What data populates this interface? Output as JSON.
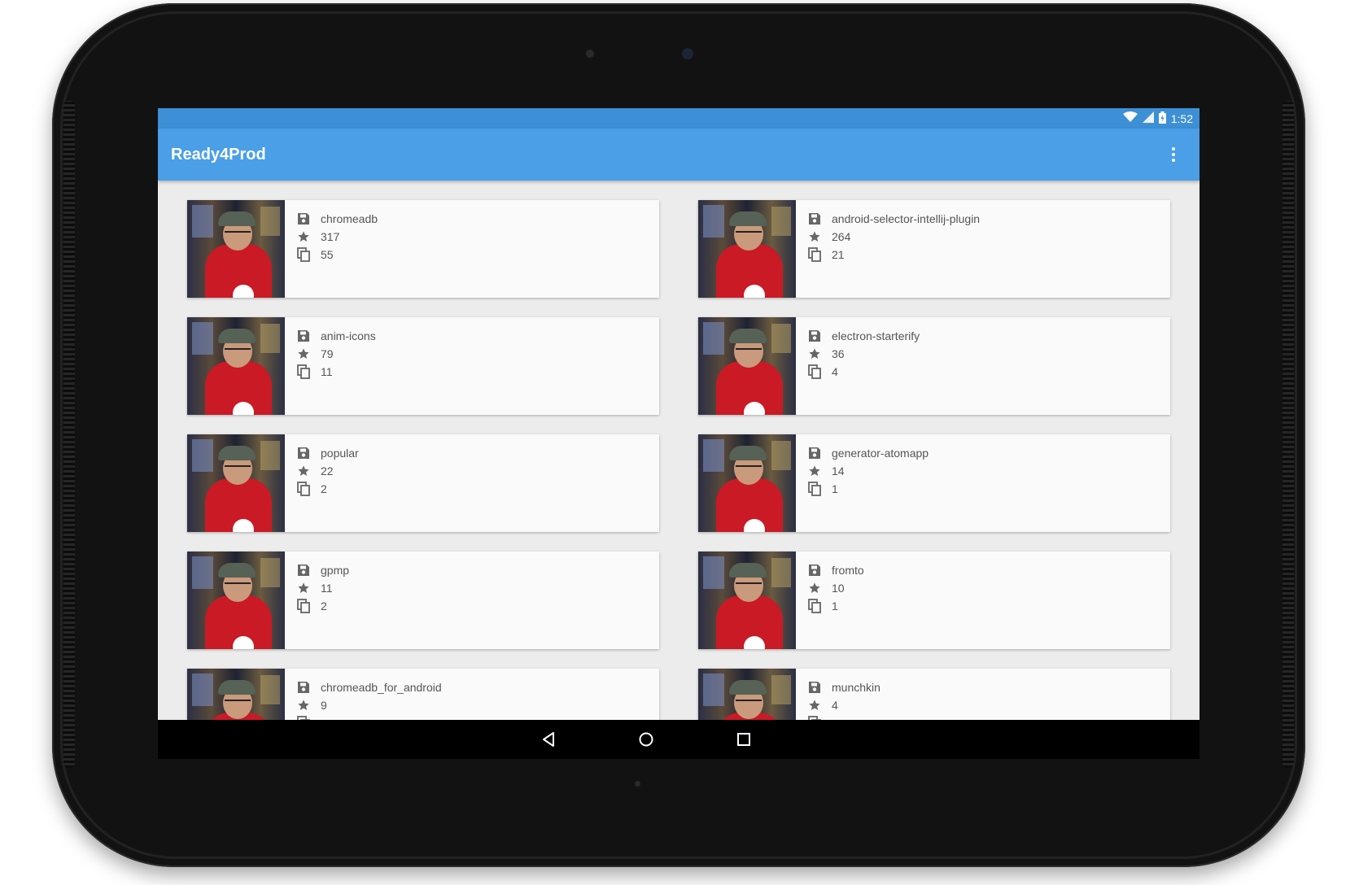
{
  "status": {
    "time": "1:52"
  },
  "app": {
    "title": "Ready4Prod"
  },
  "repos": [
    {
      "name": "chromeadb",
      "stars": "317",
      "forks": "55"
    },
    {
      "name": "android-selector-intellij-plugin",
      "stars": "264",
      "forks": "21"
    },
    {
      "name": "anim-icons",
      "stars": "79",
      "forks": "11"
    },
    {
      "name": "electron-starterify",
      "stars": "36",
      "forks": "4"
    },
    {
      "name": "popular",
      "stars": "22",
      "forks": "2"
    },
    {
      "name": "generator-atomapp",
      "stars": "14",
      "forks": "1"
    },
    {
      "name": "gpmp",
      "stars": "11",
      "forks": "2"
    },
    {
      "name": "fromto",
      "stars": "10",
      "forks": "1"
    },
    {
      "name": "chromeadb_for_android",
      "stars": "9",
      "forks": ""
    },
    {
      "name": "munchkin",
      "stars": "4",
      "forks": ""
    }
  ],
  "icons": {
    "repo": "save-icon",
    "stars": "star-icon",
    "forks": "copy-icon",
    "overflow": "more-vert-icon",
    "nav": [
      "back-icon",
      "home-icon",
      "recents-icon"
    ],
    "status": [
      "wifi-icon",
      "signal-icon",
      "battery-icon"
    ]
  },
  "colors": {
    "appbar": "#4a9fe6",
    "statusbar": "#3d8fd6",
    "card_bg": "#fafafa",
    "avatar_shirt": "#c91a26"
  }
}
